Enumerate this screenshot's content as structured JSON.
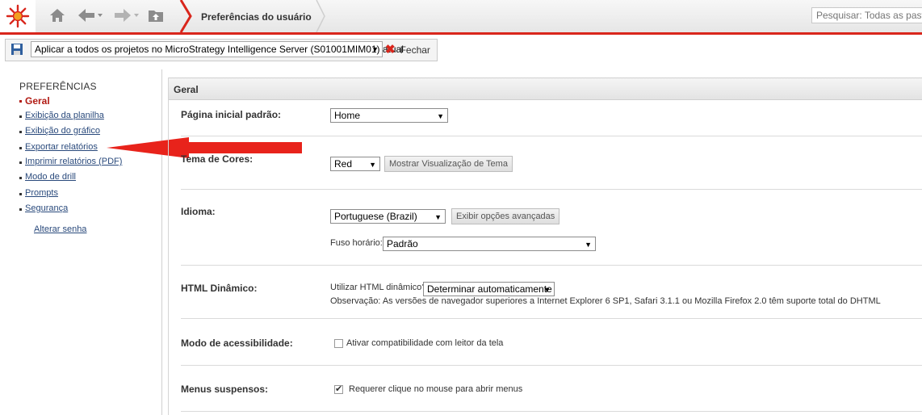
{
  "header": {
    "logo_icon": "microstrategy-sun-icon",
    "breadcrumb_title": "Preferências do usuário",
    "search_placeholder": "Pesquisar: Todas as pastas"
  },
  "toolbar": {
    "scope_value": "Aplicar a todos os projetos no MicroStrategy Intelligence Server (S01001MIM01) atual",
    "close_label": "Fechar"
  },
  "sidebar": {
    "title": "PREFERÊNCIAS",
    "items": [
      {
        "label": "Geral",
        "active": true
      },
      {
        "label": "Exibição da planilha"
      },
      {
        "label": "Exibição do gráfico"
      },
      {
        "label": "Exportar relatórios"
      },
      {
        "label": "Imprimir relatórios (PDF)"
      },
      {
        "label": "Modo de drill"
      },
      {
        "label": "Prompts"
      },
      {
        "label": "Segurança"
      }
    ],
    "change_password": "Alterar senha"
  },
  "main": {
    "section_title": "Geral",
    "home_label": "Página inicial padrão:",
    "home_value": "Home",
    "theme_label": "Tema de Cores:",
    "theme_value": "Red",
    "theme_preview_button": "Mostrar Visualização de Tema",
    "language_label": "Idioma:",
    "language_value": "Portuguese (Brazil)",
    "advanced_button": "Exibir opções avançadas",
    "timezone_label": "Fuso horário:",
    "timezone_value": "Padrão",
    "dhtml_label": "HTML Dinâmico:",
    "dhtml_use_label": "Utilizar HTML dinâmico?",
    "dhtml_value": "Determinar automaticamente",
    "dhtml_note": "Observação: As versões de navegador superiores a Internet Explorer 6 SP1, Safari 3.1.1 ou Mozilla Firefox 2.0 têm suporte total do DHTML",
    "accessibility_label": "Modo de acessibilidade:",
    "accessibility_option": "Ativar compatibilidade com leitor da tela",
    "accessibility_checked": false,
    "menus_label": "Menus suspensos:",
    "menus_option": "Requerer clique no mouse para abrir menus",
    "menus_checked": true
  },
  "colors": {
    "accent": "#d9261c",
    "link": "#2a4a7c",
    "active_link": "#b11b14",
    "annotation_arrow": "#e8231b"
  }
}
